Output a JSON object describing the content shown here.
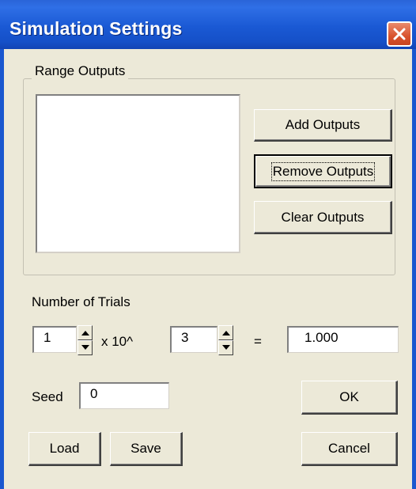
{
  "window": {
    "title": "Simulation Settings",
    "close_icon": "close-x-icon",
    "colors": {
      "titlebar": "#1a59d4",
      "close": "#d9532d",
      "face": "#ece9d8"
    }
  },
  "range_outputs": {
    "legend": "Range Outputs",
    "add_label": "Add Outputs",
    "remove_label": "Remove Outputs",
    "clear_label": "Clear Outputs"
  },
  "trials": {
    "label": "Number of Trials",
    "mantissa": "1",
    "multiplier_label": "x 10^",
    "exponent": "3",
    "equals": "=",
    "result": "1.000"
  },
  "seed": {
    "label": "Seed",
    "value": "0"
  },
  "buttons": {
    "ok_label": "OK",
    "cancel_label": "Cancel",
    "load_label": "Load",
    "save_label": "Save"
  }
}
